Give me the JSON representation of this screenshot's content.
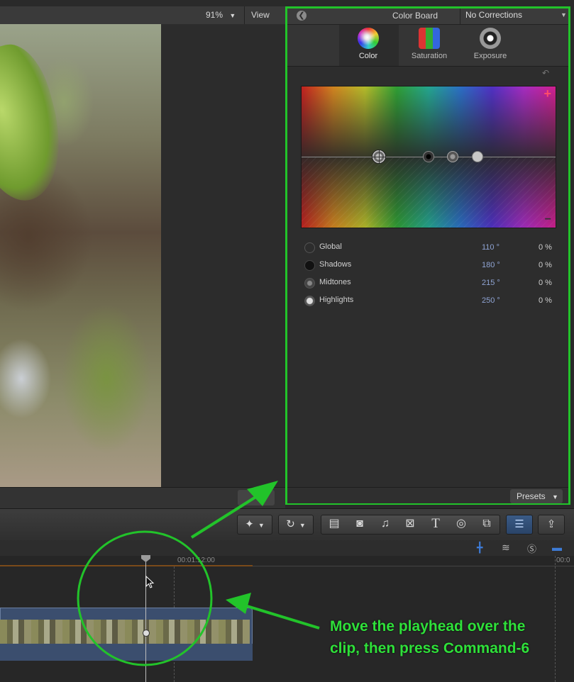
{
  "viewer": {
    "zoom": "91%",
    "view_label": "View"
  },
  "color_board": {
    "title": "Color Board",
    "corrections": "No Corrections",
    "tabs": [
      {
        "label": "Color",
        "icon": "color-wheel-icon",
        "selected": true
      },
      {
        "label": "Saturation",
        "icon": "saturation-icon",
        "selected": false
      },
      {
        "label": "Exposure",
        "icon": "exposure-icon",
        "selected": false
      }
    ],
    "rows": [
      {
        "name": "Global",
        "degrees": "110 °",
        "percent": "0 %"
      },
      {
        "name": "Shadows",
        "degrees": "180 °",
        "percent": "0 %"
      },
      {
        "name": "Midtones",
        "degrees": "215 °",
        "percent": "0 %"
      },
      {
        "name": "Highlights",
        "degrees": "250 °",
        "percent": "0 %"
      }
    ],
    "plus": "+",
    "minus": "−",
    "presets_label": "Presets"
  },
  "timeline": {
    "timecode": "00:01:12:00",
    "timecode_right": "00:0"
  },
  "annotation": {
    "line1": "Move the playhead over the",
    "line2": "clip, then press Command-6"
  },
  "colors": {
    "highlight_green": "#22c32a",
    "clip_blue": "#3b4e6e",
    "degree_text": "#8fa4d4"
  }
}
